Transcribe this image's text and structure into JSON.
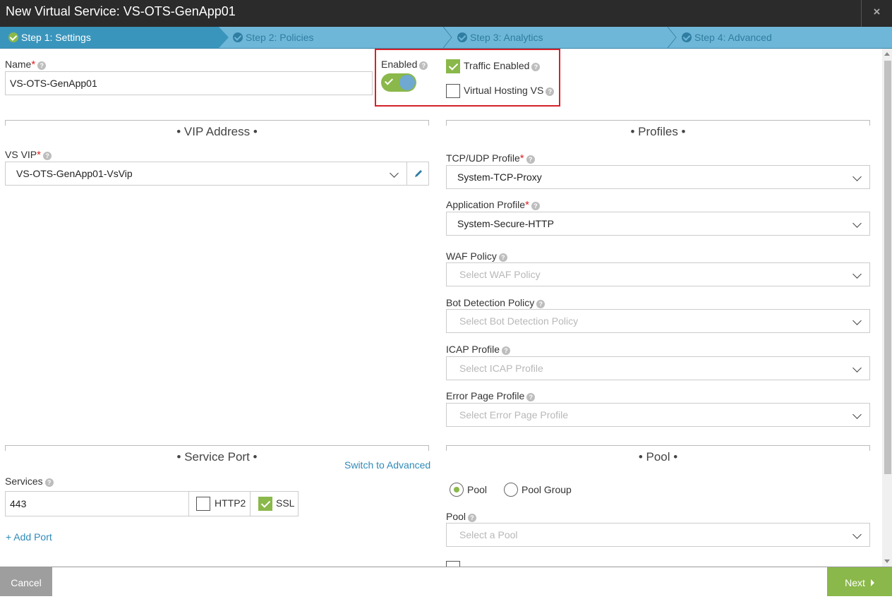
{
  "window": {
    "title": "New Virtual Service: VS-OTS-GenApp01",
    "close_glyph": "×"
  },
  "wizard": {
    "steps": [
      {
        "label": "Step 1: Settings",
        "active": true
      },
      {
        "label": "Step 2: Policies",
        "active": false
      },
      {
        "label": "Step 3: Analytics",
        "active": false
      },
      {
        "label": "Step 4: Advanced",
        "active": false
      }
    ]
  },
  "name_field": {
    "label": "Name",
    "value": "VS-OTS-GenApp01"
  },
  "enabled": {
    "label": "Enabled",
    "on": true
  },
  "traffic_enabled": {
    "label": "Traffic Enabled",
    "checked": true
  },
  "virtual_hosting": {
    "label": "Virtual Hosting VS",
    "checked": false
  },
  "vip_section": {
    "title": "• VIP Address •",
    "vs_vip": {
      "label": "VS VIP",
      "value": "VS-OTS-GenApp01-VsVip"
    }
  },
  "profiles_section": {
    "title": "• Profiles •",
    "tcp_udp": {
      "label": "TCP/UDP Profile",
      "value": "System-TCP-Proxy"
    },
    "application": {
      "label": "Application Profile",
      "value": "System-Secure-HTTP"
    },
    "waf": {
      "label": "WAF Policy",
      "placeholder": "Select WAF Policy"
    },
    "bot": {
      "label": "Bot Detection Policy",
      "placeholder": "Select Bot Detection Policy"
    },
    "icap": {
      "label": "ICAP Profile",
      "placeholder": "Select ICAP Profile"
    },
    "error_page": {
      "label": "Error Page Profile",
      "placeholder": "Select Error Page Profile"
    }
  },
  "service_section": {
    "title": "• Service Port •",
    "switch_link": "Switch to Advanced",
    "services_label": "Services",
    "port_value": "443",
    "http2": {
      "label": "HTTP2",
      "checked": false
    },
    "ssl": {
      "label": "SSL",
      "checked": true
    },
    "add_port": "+ Add Port"
  },
  "pool_section": {
    "title": "• Pool •",
    "radio_pool": {
      "label": "Pool",
      "selected": true
    },
    "radio_pool_group": {
      "label": "Pool Group",
      "selected": false
    },
    "pool_label": "Pool",
    "pool_placeholder": "Select a Pool"
  },
  "footer": {
    "cancel": "Cancel",
    "next": "Next"
  },
  "colors": {
    "accent_green": "#8ab84a",
    "wizard_blue": "#6fb7d8",
    "active_step": "#3a95bc",
    "highlight_red": "#d6222a"
  }
}
